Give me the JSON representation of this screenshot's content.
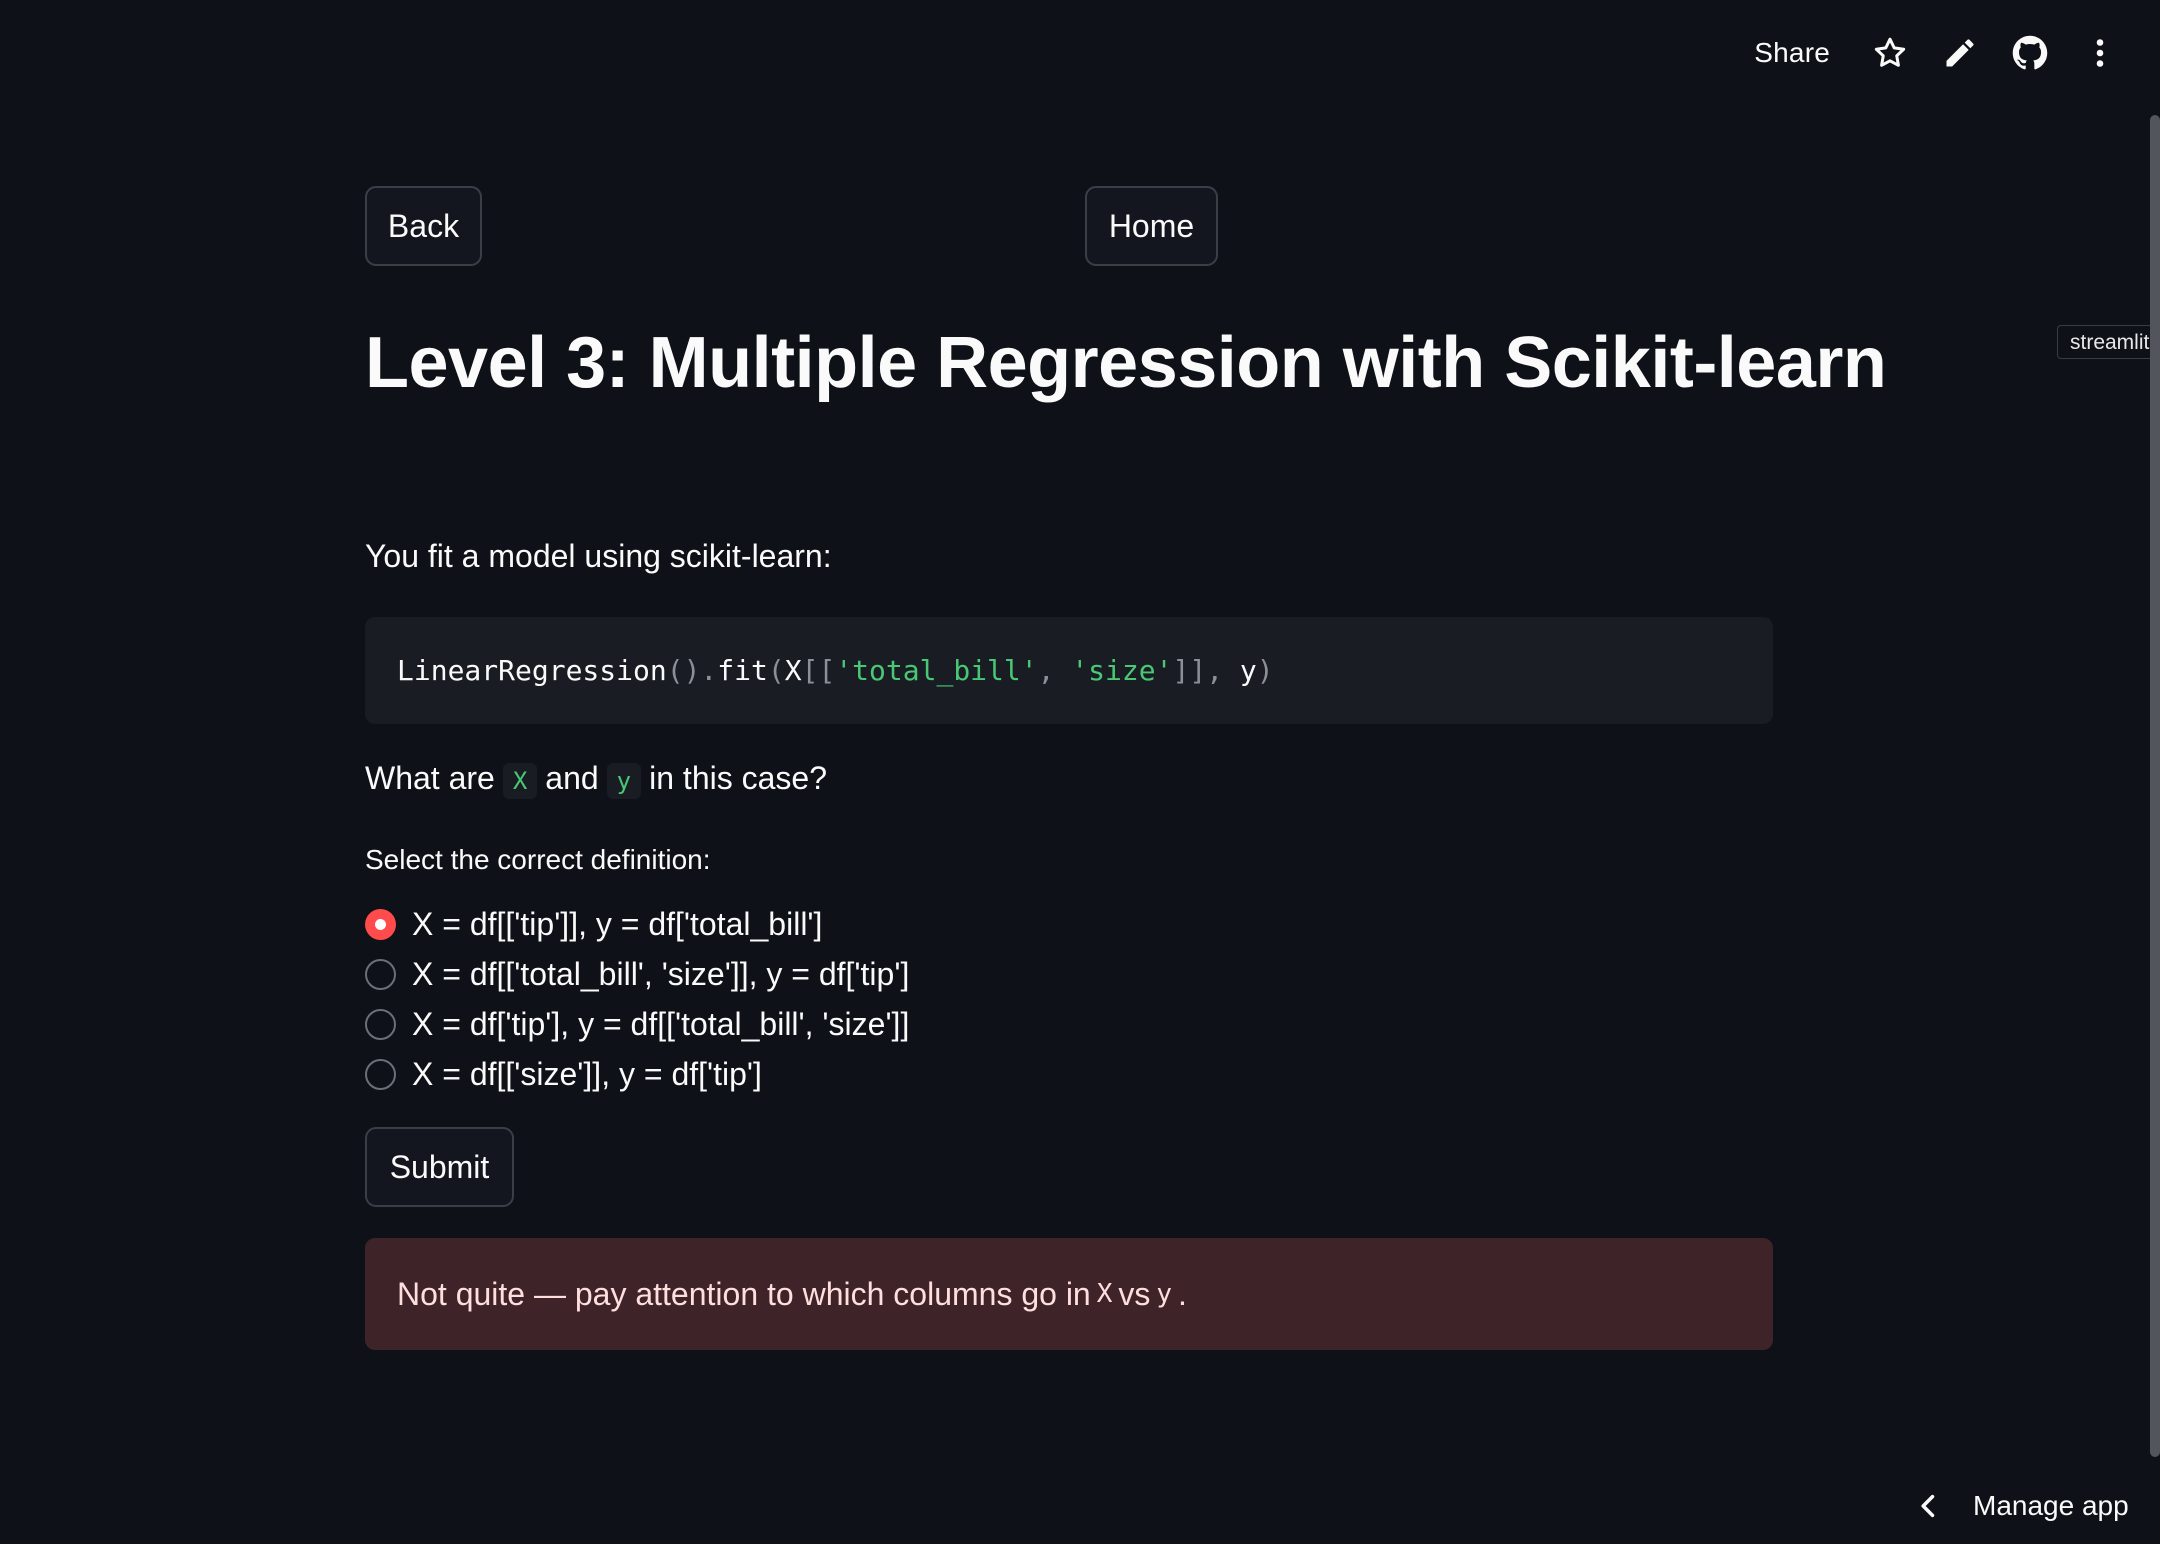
{
  "toolbar": {
    "share_label": "Share",
    "icons": [
      "star-icon",
      "pencil-icon",
      "github-icon",
      "more-vertical-icon"
    ]
  },
  "side_tag": {
    "label": "streamlit"
  },
  "nav": {
    "back_label": "Back",
    "home_label": "Home"
  },
  "page": {
    "title": "Level 3: Multiple Regression with Scikit-learn",
    "intro": "You fit a model using scikit-learn:"
  },
  "code": {
    "t1": "LinearRegression",
    "t2": "().",
    "t3": "fit",
    "t4": "(",
    "t5": "X",
    "t6": "[[",
    "t7": "'total_bill'",
    "t8": ", ",
    "t9": "'size'",
    "t10": "]], ",
    "t11": "y",
    "t12": ")"
  },
  "question": {
    "part1": "What are",
    "code1": "X",
    "part2": "and",
    "code2": "y",
    "part3": "in this case?"
  },
  "radio": {
    "label": "Select the correct definition:",
    "selected_index": 0,
    "options": [
      "X = df[['tip']], y = df['total_bill']",
      "X = df[['total_bill', 'size']], y = df['tip']",
      "X = df['tip'], y = df[['total_bill', 'size']]",
      "X = df[['size']], y = df['tip']"
    ]
  },
  "submit_label": "Submit",
  "alert": {
    "part1": "Not quite — pay attention to which columns go in",
    "code1": "X",
    "part2": "vs",
    "code2": "y",
    "part3": "."
  },
  "footer": {
    "manage_label": "Manage app"
  },
  "colors": {
    "background": "#0e1117",
    "accent": "#ff4b4b",
    "code_string": "#48c774",
    "error_bg": "#3e2428"
  }
}
